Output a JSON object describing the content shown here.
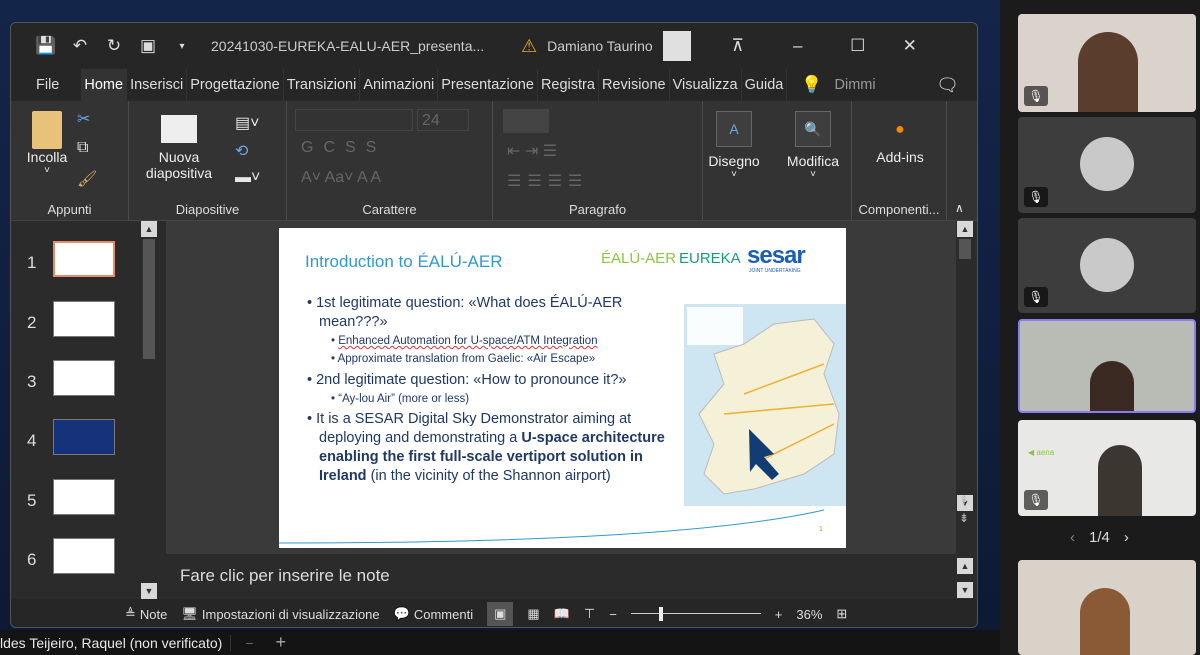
{
  "window": {
    "filename": "20241030-EUREKA-EALU-AER_presenta...",
    "user": "Damiano Taurino"
  },
  "tabs": [
    "File",
    "Home",
    "Inserisci",
    "Progettazione",
    "Transizioni",
    "Animazioni",
    "Presentazione",
    "Registra",
    "Revisione",
    "Visualizza",
    "Guida"
  ],
  "search_label": "Dimmi",
  "ribbon": {
    "paste": "Incolla",
    "clipboard": "Appunti",
    "new_slide_1": "Nuova",
    "new_slide_2": "diapositiva",
    "slides": "Diapositive",
    "font_size": "24",
    "font": "Carattere",
    "paragraph": "Paragrafo",
    "drawing": "Disegno",
    "edit": "Modifica",
    "addins": "Add-ins",
    "components": "Componenti..."
  },
  "thumbs": [
    "1",
    "2",
    "3",
    "4",
    "5",
    "6"
  ],
  "slide": {
    "title": "Introduction to ÉALÚ-AER",
    "logo1": "ÉALÚ-AER",
    "logo2": "EUREKA",
    "logo3": "sesar",
    "logo3_sub": "JOINT UNDERTAKING",
    "b1a": "1st legitimate question: «What does ÉALÚ-AER mean???»",
    "b1s1": "Enhanced Automation for U-space/ATM Integration",
    "b1s2": "Approximate translation from Gaelic: «Air Escape»",
    "b2": "2nd legitimate question: «How to pronounce it?»",
    "b2s1": "“Ay-lou Air” (more or less)",
    "b3a": "It is a SESAR Digital Sky Demonstrator aiming at deploying and demonstrating a ",
    "b3b": "U-space architecture enabling the first full-scale vertiport solution in Ireland",
    "b3c": " (in the vicinity of the Shannon airport)",
    "page": "1"
  },
  "notes_placeholder": "Fare clic per inserire le note",
  "status": {
    "notes": "Note",
    "display": "Impostazioni di visualizzazione",
    "comments": "Commenti",
    "zoom": "36%"
  },
  "bottom": {
    "name": "ldes Teijeiro, Raquel (non verificato)",
    "minus": "−",
    "plus": "+"
  },
  "pager": "1/4",
  "colors": {
    "accent": "#8b7cf6",
    "slide_title": "#2e9ad0"
  }
}
